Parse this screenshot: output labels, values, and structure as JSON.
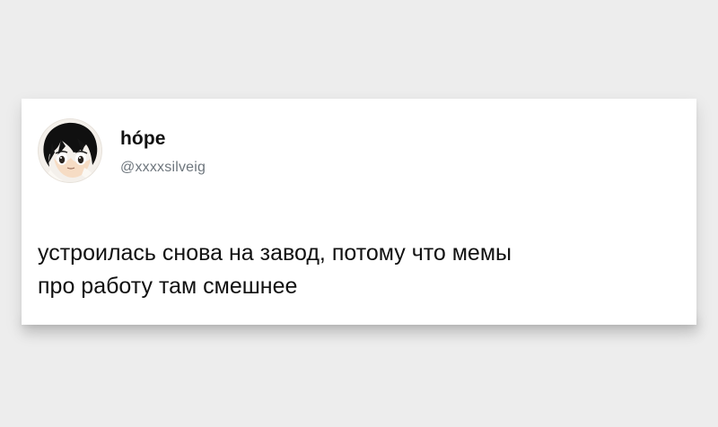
{
  "tweet": {
    "author": {
      "display_name": "hópe",
      "handle": "@xxxxsilveig",
      "avatar": "anime-character-avatar"
    },
    "text": "устроилась снова на завод, потому что мемы\nпро работу там смешнее"
  },
  "colors": {
    "background": "#ededed",
    "card": "#ffffff",
    "text": "#111111",
    "muted": "#6e767d"
  }
}
